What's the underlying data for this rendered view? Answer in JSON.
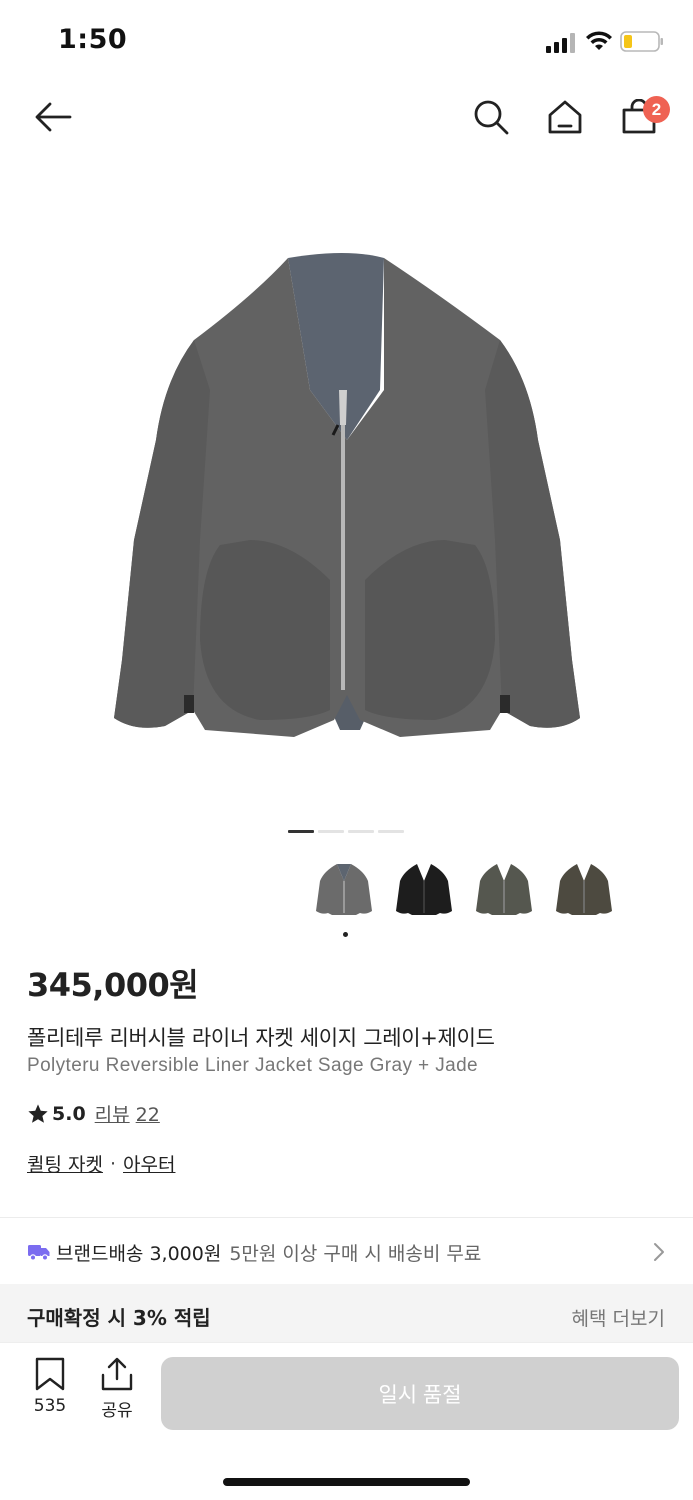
{
  "status_bar": {
    "time": "1:50"
  },
  "nav": {
    "cart_count": "2"
  },
  "gallery": {
    "page_count": 4,
    "active_page": 1,
    "thumbnails": [
      "sage-gray",
      "black",
      "olive",
      "brown"
    ],
    "selected_thumbnail": 0
  },
  "product": {
    "price": "345,000원",
    "name_ko": "폴리테루 리버시블 라이너 자켓 세이지 그레이+제이드",
    "name_en": "Polyteru Reversible Liner Jacket Sage Gray + Jade",
    "rating": "5.0",
    "review_label": "리뷰",
    "review_count": "22",
    "categories": [
      "퀼팅 자켓",
      "아우터"
    ],
    "category_separator": "·"
  },
  "shipping": {
    "label": "브랜드배송 3,000원",
    "note": "5만원 이상 구매 시 배송비 무료"
  },
  "benefit": {
    "title": "구매확정 시 3% 적립",
    "more_label": "혜택 더보기"
  },
  "bottom_bar": {
    "bookmark_count": "535",
    "share_label": "공유",
    "soldout_label": "일시 품절"
  },
  "colors": {
    "badge": "#ef6253",
    "truck": "#7b6cf0",
    "soldout_button": "#d0d0d0",
    "battery_fill": "#f5c518"
  }
}
